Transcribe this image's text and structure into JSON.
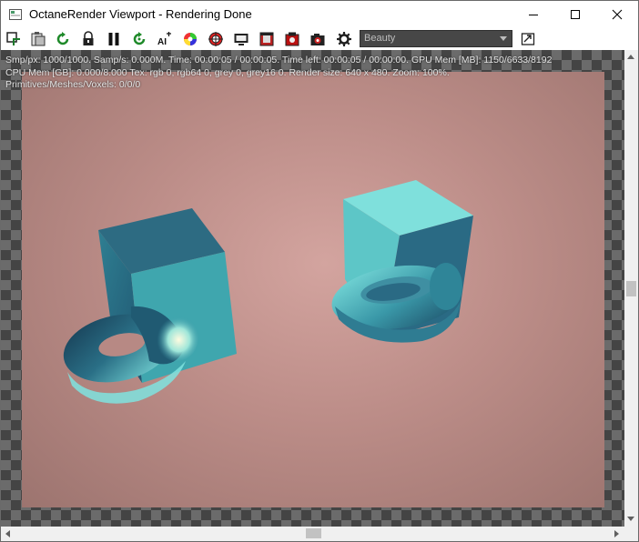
{
  "window": {
    "title": "OctaneRender Viewport - Rendering Done"
  },
  "toolbar": {
    "buttons": [
      "recenter-icon",
      "clipboard-icon",
      "restart-render-icon",
      "lock-icon",
      "pause-icon",
      "reset-icon",
      "ai-light-icon",
      "color-picker-icon",
      "focus-picker-icon",
      "region-render-icon",
      "film-region-icon",
      "save-image-icon",
      "camera-icon",
      "settings-icon"
    ],
    "render_pass_select": "Beauty"
  },
  "stats": {
    "line1": "Smp/px: 1000/1000.   Samp/s: 0.000M.   Time: 00:00:05 / 00:00:05.   Time left: 00:00:05 / 00:00:00.   GPU Mem [MB]: 1150/6633/8192",
    "line2": "CPU Mem [GB]: 0.000/8.000   Tex: rgb 0, rgb64 0, grey 0, grey16 0.   Render size: 640 x 480.   Zoom: 100%.",
    "line3": "Primitives/Meshes/Voxels: 0/0/0"
  },
  "colors": {
    "background_pink": "#c89a95",
    "mesh_teal": "#3fa6ae",
    "mesh_light": "#7fe3df",
    "select_bg": "#474747"
  }
}
